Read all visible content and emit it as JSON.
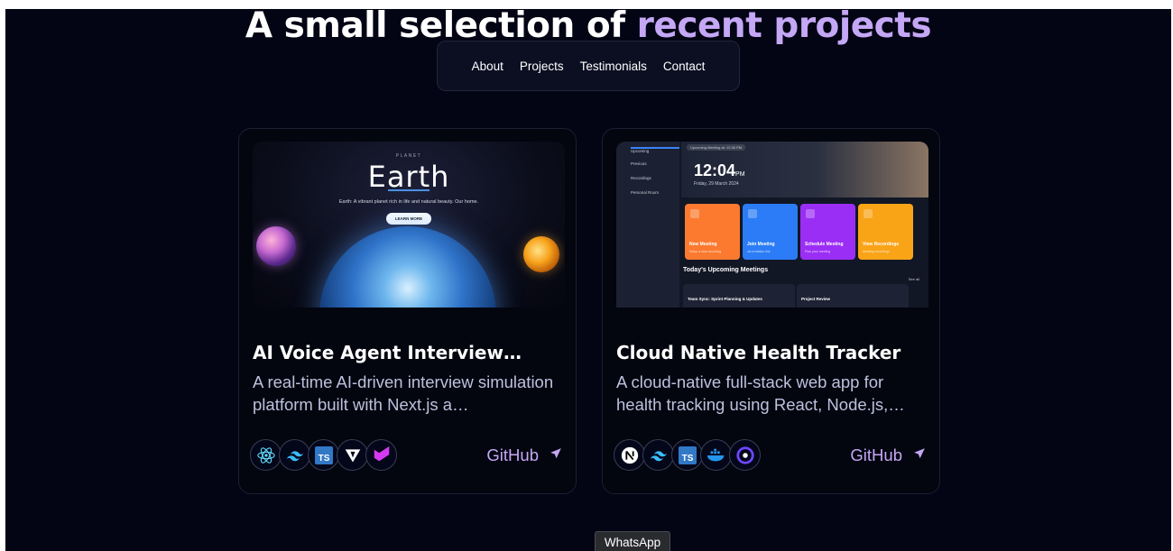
{
  "hero": {
    "title_main": "A small selection of",
    "title_accent": "recent projects"
  },
  "nav": {
    "items": [
      "About",
      "Projects",
      "Testimonials",
      "Contact"
    ]
  },
  "projects": [
    {
      "title": "AI Voice Agent Interview…",
      "description": "A real-time AI-driven interview simulation platform built with Next.js a…",
      "thumbnail": {
        "tag": "PLANET",
        "heading": "Earth",
        "subtitle": "Earth: A vibrant planet rich in life and natural beauty. Our home.",
        "button": "LEARN MORE"
      },
      "tech_icons": [
        "react-icon",
        "tailwind-icon",
        "typescript-icon",
        "vite-icon",
        "mui-icon"
      ],
      "link_label": "GitHub"
    },
    {
      "title": "Cloud Native Health Tracker",
      "description": "A cloud-native full-stack web app for health tracking using React, Node.js,…",
      "thumbnail": {
        "sidebar": [
          "Upcoming",
          "Previous",
          "Recordings",
          "Personal Room"
        ],
        "pill": "Upcoming Meeting at: 12:30 PM",
        "time": "12:04",
        "time_suffix": "PM",
        "date": "Friday, 29 March 2024",
        "tiles": [
          {
            "label": "New Meeting",
            "sub": "Setup a new recording",
            "color": "#fb7a30"
          },
          {
            "label": "Join Meeting",
            "sub": "via invitation link",
            "color": "#2b7cf6"
          },
          {
            "label": "Schedule Meeting",
            "sub": "Plan your meeting",
            "color": "#9b2ef5"
          },
          {
            "label": "View Recordings",
            "sub": "Meeting recordings",
            "color": "#f9a317"
          }
        ],
        "section_title": "Today's Upcoming Meetings",
        "see_all": "See all",
        "meeting_1": "Team Sync: Sprint Planning & Updates",
        "meeting_2": "Project Review"
      },
      "tech_icons": [
        "nextjs-icon",
        "tailwind-icon",
        "typescript-icon",
        "docker-icon",
        "clerk-icon"
      ],
      "link_label": "GitHub"
    }
  ],
  "whatsapp": {
    "label": "WhatsApp"
  },
  "colors": {
    "background": "#030414",
    "accent": "#c4a7f5",
    "card_border": "#1c1f33"
  }
}
